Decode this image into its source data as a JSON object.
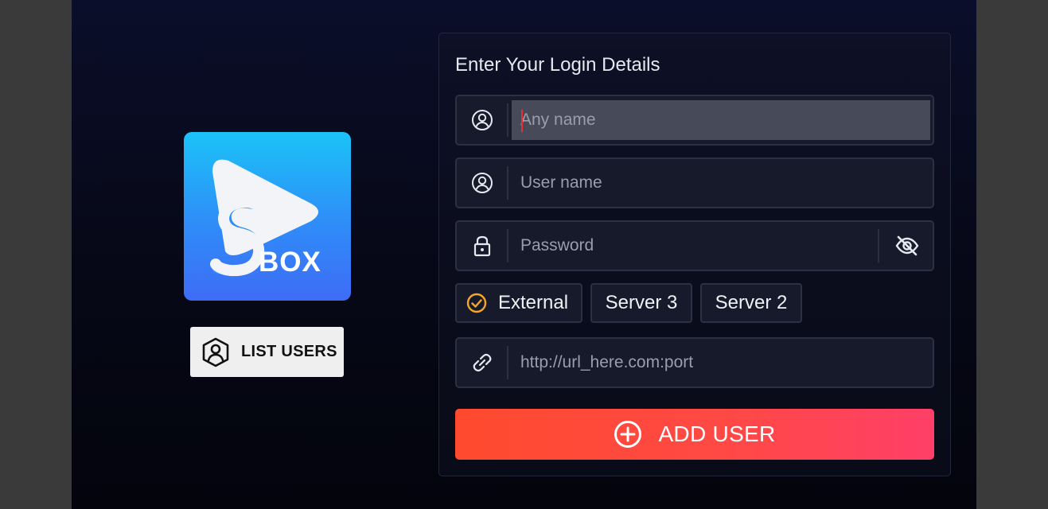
{
  "list_users_label": "LIST USERS",
  "logo": {
    "text": "BOX",
    "letter": "S"
  },
  "form": {
    "title": "Enter Your Login Details",
    "any_name_placeholder": "Any name",
    "user_name_placeholder": "User name",
    "password_placeholder": "Password",
    "url_placeholder": "http://url_here.com:port"
  },
  "servers": [
    {
      "label": "External",
      "selected": true
    },
    {
      "label": "Server 3",
      "selected": false
    },
    {
      "label": "Server 2",
      "selected": false
    }
  ],
  "add_user_label": "ADD USER",
  "icons": {
    "any_name": "user-circle-icon",
    "user_name": "user-circle-icon",
    "password": "lock-icon",
    "toggle_password": "eye-off-icon",
    "url": "link-icon",
    "selected": "check-circle-icon",
    "add": "plus-circle-icon",
    "list_users": "user-hexagon-icon"
  },
  "colors": {
    "accent_check": "#f5a623",
    "add_button_start": "#ff4a2f",
    "add_button_end": "#ff3f68",
    "logo_top": "#1bc3f7",
    "logo_bottom": "#3e6cf6"
  }
}
